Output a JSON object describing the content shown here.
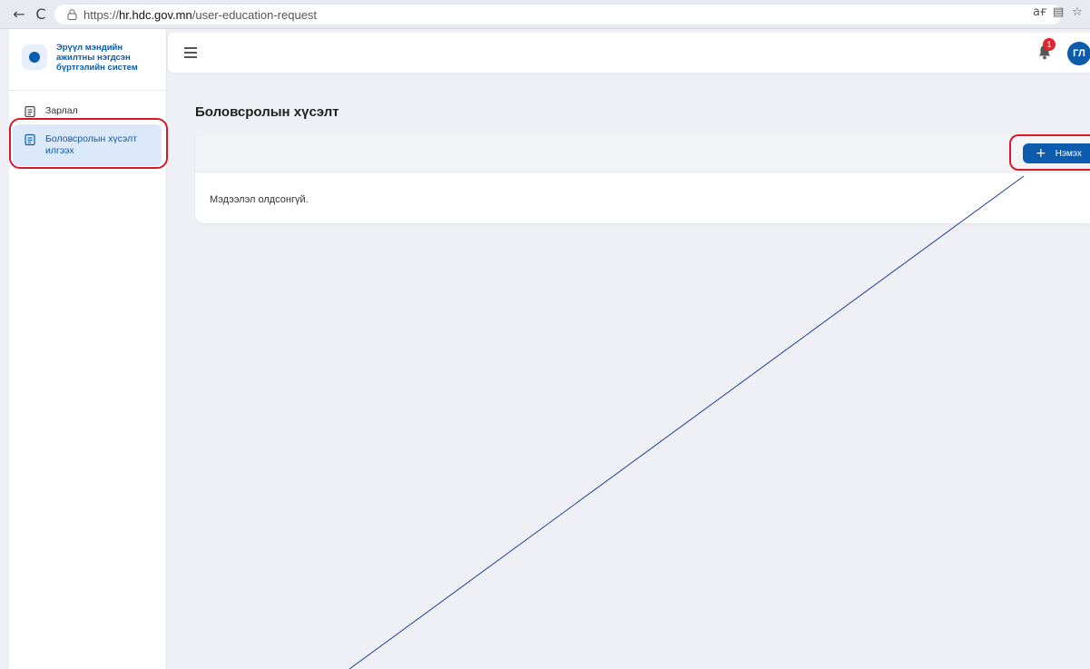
{
  "browser": {
    "back_icon": "←",
    "reload_icon": "C",
    "url_prefix": "https://",
    "url_host": "hr.hdc.gov.mn",
    "url_path": "/user-education-request",
    "translate_icon": "aғ",
    "reader_icon": "▤",
    "star_icon": "☆"
  },
  "sidebar": {
    "brand_name": "Эрүүл мэндийн ажилтны нэгдсэн бүртгэлийн систем",
    "items": [
      {
        "label": "Зарлал",
        "active": false
      },
      {
        "label": "Боловсролын хүсэлт илгээх",
        "active": true
      }
    ]
  },
  "topbar": {
    "notification_count": "1",
    "avatar_initials": "ГЛ"
  },
  "main": {
    "page_title": "Боловсролын хүсэлт",
    "add_button_label": "Нэмэх",
    "empty_message": "Мэдээлэл олдсонгүй."
  },
  "colors": {
    "primary": "#0b5cad",
    "active_bg": "#dbe9fb",
    "annotation": "#d9182a",
    "badge": "#e0242f",
    "page_bg": "#eef0f5"
  }
}
